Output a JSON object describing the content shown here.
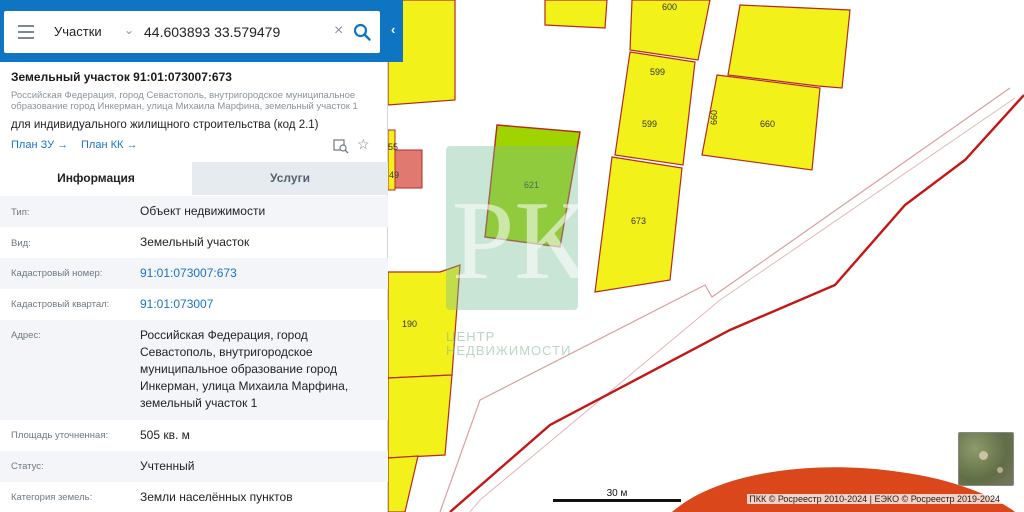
{
  "search": {
    "layer": "Участки",
    "value": "44.603893 33.579479"
  },
  "parcel": {
    "title": "Земельный участок 91:01:073007:673",
    "address_short": "Российская Федерация, город Севастополь, внутригородское муниципальное образование город Инкерман, улица Михаила Марфина, земельный участок 1",
    "purpose": "для индивидуального жилищного строительства (код 2.1)",
    "plan_zu": "План ЗУ →",
    "plan_kk": "План КК →"
  },
  "tabs": {
    "info": "Информация",
    "services": "Услуги"
  },
  "properties": [
    {
      "key": "Тип:",
      "value": "Объект недвижимости"
    },
    {
      "key": "Вид:",
      "value": "Земельный участок"
    },
    {
      "key": "Кадастровый номер:",
      "value": "91:01:073007:673"
    },
    {
      "key": "Кадастровый квартал:",
      "value": "91:01:073007"
    },
    {
      "key": "Адрес:",
      "value": "Российская Федерация, город Севастополь, внутригородское муниципальное образование город Инкерман, улица Михаила Марфина, земельный участок 1"
    },
    {
      "key": "Площадь уточненная:",
      "value": "505 кв. м"
    },
    {
      "key": "Статус:",
      "value": "Учтенный"
    },
    {
      "key": "Категория земель:",
      "value": "Земли населённых пунктов"
    }
  ],
  "map": {
    "plot_labels": {
      "p600": "600",
      "p599a": "599",
      "p599b": "599",
      "p660a": "660",
      "p660b": "660",
      "p621": "621",
      "p673": "673",
      "p190": "190",
      "p55": "55",
      "p49": "49"
    },
    "watermark_letters": "РК",
    "watermark_text_1": "ЦЕНТР",
    "watermark_text_2": "НЕДВИЖИМОСТИ",
    "scale": "30 м",
    "attribution": "ПКК © Росреестр 2010-2024 | ЕЭКО © Росреестр 2019-2024"
  },
  "colors": {
    "brand": "#0f75c2",
    "parcel_fill": "#f2f21a",
    "parcel_border": "#b7281f",
    "selected_fill": "#9fd400",
    "link": "#1a73c8"
  }
}
